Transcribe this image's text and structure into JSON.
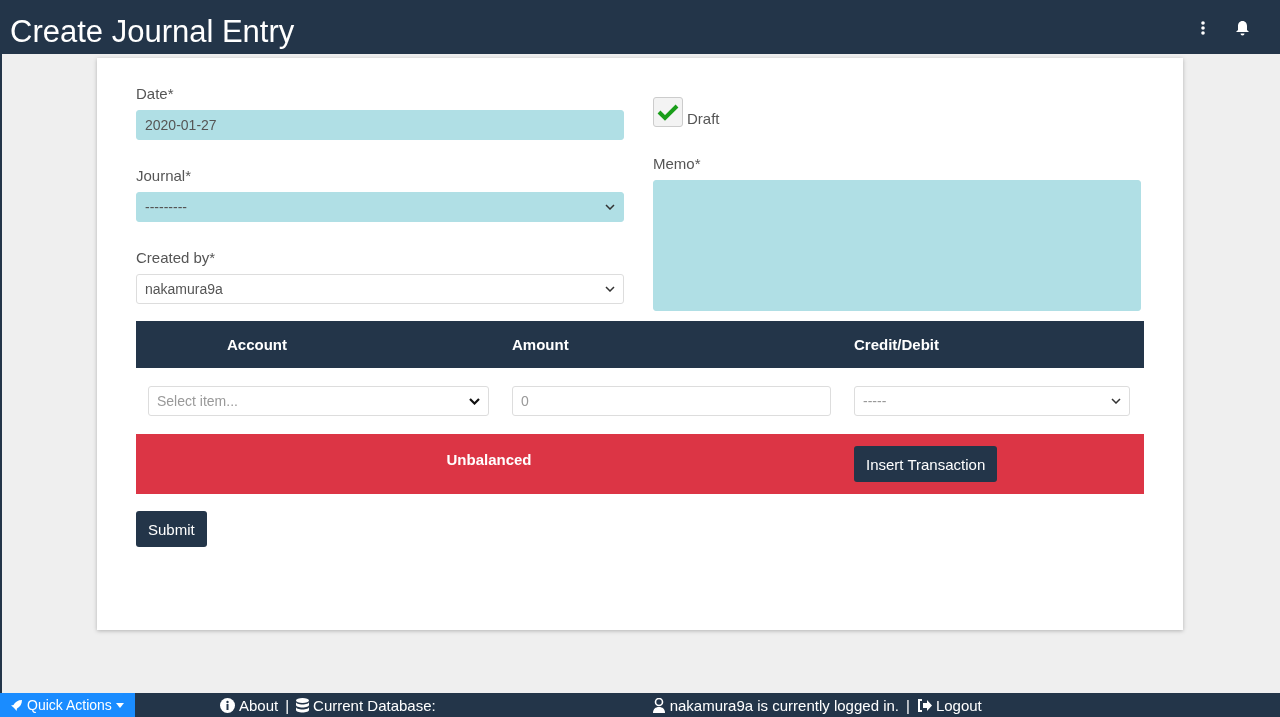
{
  "header": {
    "title": "Create Journal Entry"
  },
  "form": {
    "left_fields": [
      {
        "label": "Date*",
        "kind": "text",
        "value": "2020-01-27",
        "highlighted": true
      },
      {
        "label": "Journal*",
        "kind": "select",
        "value": "---------",
        "highlighted": true
      },
      {
        "label": "Created by*",
        "kind": "select",
        "value": "nakamura9a",
        "highlighted": false
      }
    ],
    "draft": {
      "label": "Draft",
      "checked": true
    },
    "memo": {
      "label": "Memo*",
      "highlighted": true
    }
  },
  "table": {
    "columns": [
      "Account",
      "Amount",
      "Credit/Debit"
    ],
    "row": {
      "account": {
        "placeholder": "Select item..."
      },
      "amount": {
        "placeholder": "0"
      },
      "credit_debit": {
        "placeholder": "-----"
      }
    }
  },
  "balance": {
    "text": "Unbalanced",
    "balanced": false,
    "button": "Insert Transaction"
  },
  "submit": "Submit",
  "footer": {
    "quick_actions": "Quick Actions",
    "about": "About",
    "separator_1": "|",
    "database": "Current Database:",
    "user": "nakamura9a is currently logged in.",
    "separator_2": "|",
    "logout": "Logout"
  }
}
